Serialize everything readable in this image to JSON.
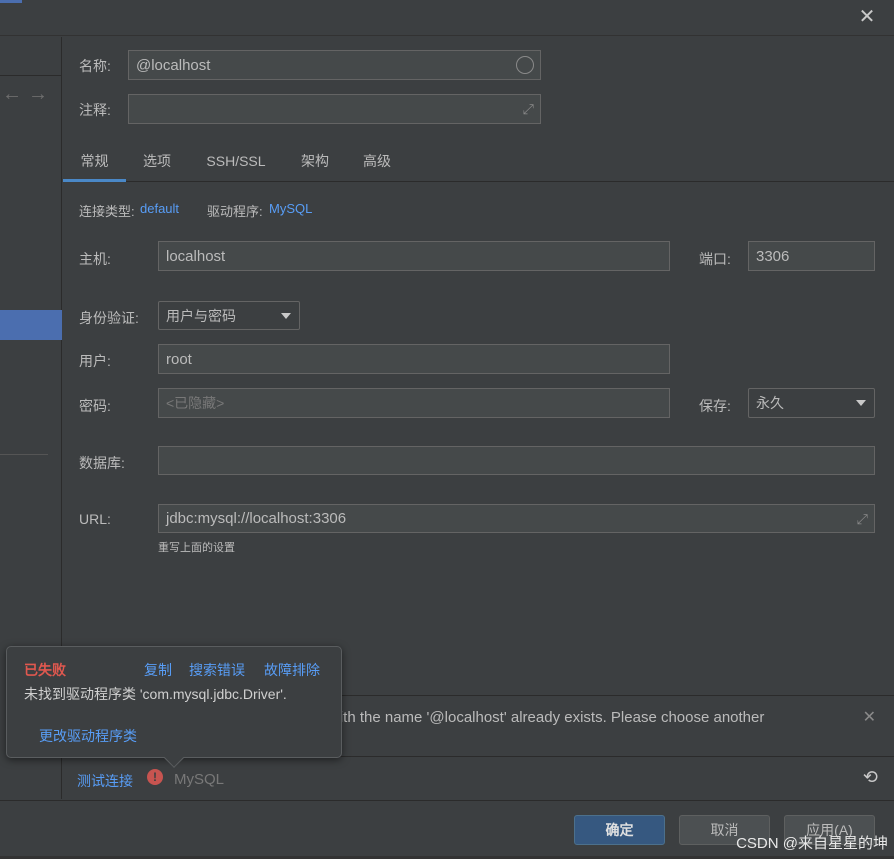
{
  "window": {
    "close_icon": "close-icon"
  },
  "form": {
    "name_label": "名称:",
    "name_value": "@localhost",
    "comment_label": "注释:",
    "comment_value": ""
  },
  "tabs": [
    {
      "label": "常规",
      "active": true
    },
    {
      "label": "选项",
      "active": false
    },
    {
      "label": "SSH/SSL",
      "active": false
    },
    {
      "label": "架构",
      "active": false
    },
    {
      "label": "高级",
      "active": false
    }
  ],
  "connection": {
    "type_label": "连接类型:",
    "type_value": "default",
    "driver_label": "驱动程序:",
    "driver_value": "MySQL"
  },
  "general": {
    "host_label": "主机:",
    "host_value": "localhost",
    "port_label": "端口:",
    "port_value": "3306",
    "auth_label": "身份验证:",
    "auth_value": "用户与密码",
    "user_label": "用户:",
    "user_value": "root",
    "password_label": "密码:",
    "password_placeholder": "<已隐藏>",
    "save_label": "保存:",
    "save_value": "永久",
    "database_label": "数据库:",
    "database_value": "",
    "url_label": "URL:",
    "url_value": "jdbc:mysql://localhost:3306",
    "url_hint": "重写上面的设置"
  },
  "banner": {
    "text": "with the name '@localhost' already exists. Please choose another"
  },
  "test": {
    "label": "测试连接",
    "driver": "MySQL"
  },
  "popup": {
    "status": "已失败",
    "copy": "复制",
    "search_error": "搜索错误",
    "troubleshoot": "故障排除",
    "message": "未找到驱动程序类 'com.mysql.jdbc.Driver'.",
    "change_driver": "更改驱动程序类"
  },
  "footer": {
    "ok": "确定",
    "cancel": "取消",
    "apply": "应用(A)",
    "watermark": "CSDN @来自星星的坤"
  },
  "colors": {
    "background": "#3c3f41",
    "accent": "#4b6eaf",
    "link": "#589df6",
    "error": "#e0584f",
    "primary_button": "#365880"
  }
}
